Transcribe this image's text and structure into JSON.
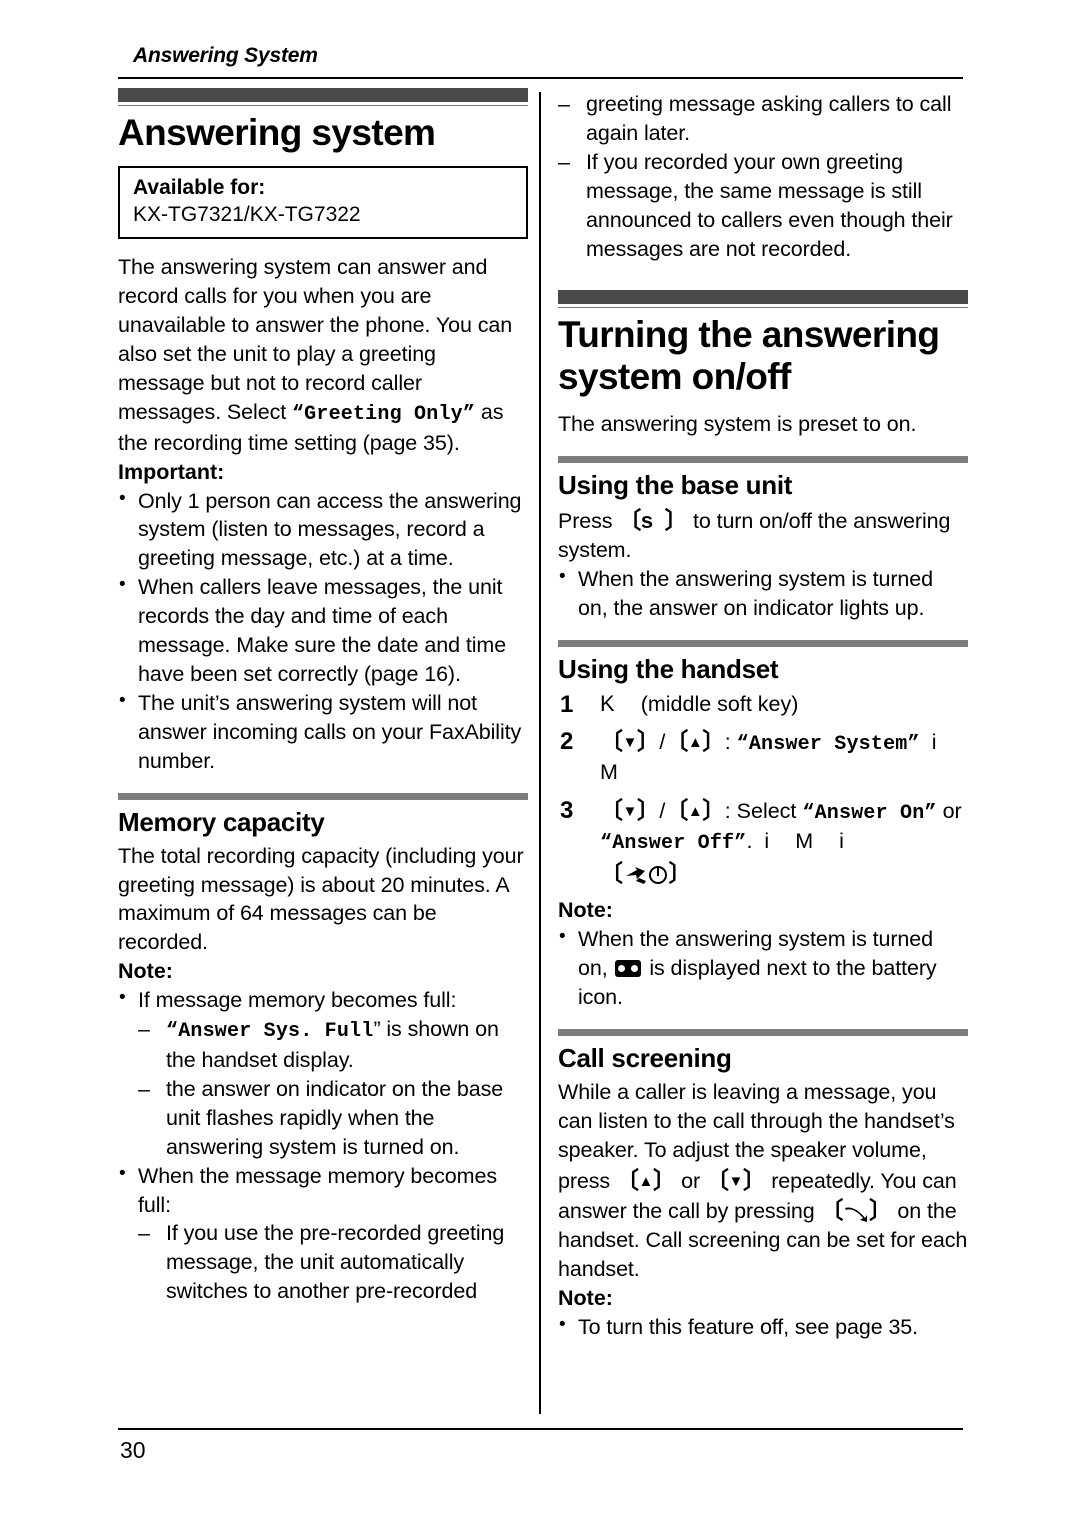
{
  "header": {
    "running_title": "Answering System"
  },
  "footer": {
    "page_number": "30"
  },
  "left_column": {
    "section_heading": "Answering system",
    "available_box": {
      "title": "Available for:",
      "models": "KX-TG7321/KX-TG7322"
    },
    "intro_part1": "The answering system can answer and record calls for you when you are unavailable to answer the phone. You can also set the unit to play a greeting message but not to record caller messages. Select ",
    "intro_quote_open": "“",
    "intro_mono": "Greeting Only",
    "intro_quote_close": "”",
    "intro_part2": " as the recording time setting (page 35).",
    "important_label": "Important:",
    "important_bullets": [
      "Only 1 person can access the answering system (listen to messages, record a greeting message, etc.) at a time.",
      "When callers leave messages, the unit records the day and time of each message. Make sure the date and time have been set correctly (page 16).",
      "The unit’s answering system will not answer incoming calls on your FaxAbility number."
    ],
    "memory_heading": "Memory capacity",
    "memory_body": "The total recording capacity (including your greeting message) is about 20 minutes. A maximum of 64 messages can be recorded.",
    "note_label": "Note:",
    "note_bullet_1": "If message memory becomes full:",
    "note_sub_1_pre": "“",
    "note_sub_1_mono": "Answer Sys. Full",
    "note_sub_1_post": "” is shown on the handset display.",
    "note_sub_2": "the answer on indicator on the base unit flashes rapidly when the answering system is turned on.",
    "note_bullet_2": "When the message memory becomes full:",
    "note_sub_3": "If you use the pre-recorded greeting message, the unit automatically switches to another pre-recorded"
  },
  "right_column": {
    "continued_text": "greeting message asking callers to call again later.",
    "continued_dash": "If you recorded your own greeting message, the same message is still announced to callers even though their messages are not recorded.",
    "section_heading": "Turning the answering system on/off",
    "preset_text": "The answering system is preset to on.",
    "base_unit_heading": "Using the base unit",
    "base_unit_press_pre": "Press ",
    "base_unit_key_glyph": "s",
    "base_unit_press_post": " to turn on/off the answering system.",
    "base_unit_bullet": "When the answering system is turned on, the answer on indicator lights up.",
    "handset_heading": "Using the handset",
    "steps": [
      {
        "num": "1",
        "key_glyph": "K",
        "text": "(middle soft key)"
      },
      {
        "num": "2",
        "key_down": "▼",
        "key_up": "▲",
        "sep": "/",
        "colon": ": ",
        "quote_open": "“",
        "mono": "Answer System",
        "quote_close": "”",
        "arrow": "i",
        "tail": "M"
      },
      {
        "num": "3",
        "key_down": "▼",
        "key_up": "▲",
        "sep": "/",
        "colon": ": Select ",
        "quote_open": "“",
        "mono_a": "Answer On",
        "quote_close": "”",
        "or_text": " or ",
        "mono_b": "Answer Off",
        "period": ".",
        "arrow1": "i",
        "tail": "M",
        "arrow2": "i"
      }
    ],
    "handset_note_label": "Note:",
    "handset_note_pre": "When the answering system is turned on, ",
    "handset_note_post": " is displayed next to the battery icon.",
    "call_screening_heading": "Call screening",
    "call_screening_part1": "While a caller is leaving a message, you can listen to the call through the handset’s speaker. To adjust the speaker volume, press ",
    "call_screening_or": " or ",
    "call_screening_part2": " repeatedly. You can answer the call by pressing ",
    "call_screening_part3": " on the handset. Call screening can be set for each handset.",
    "call_screening_note_label": "Note:",
    "call_screening_note_bullet": "To turn this feature off, see page 35."
  },
  "colors": {
    "heading_bar": "#4a4a4a",
    "subheading_bar": "#7d7d7d",
    "text": "#000000",
    "background": "#ffffff"
  }
}
